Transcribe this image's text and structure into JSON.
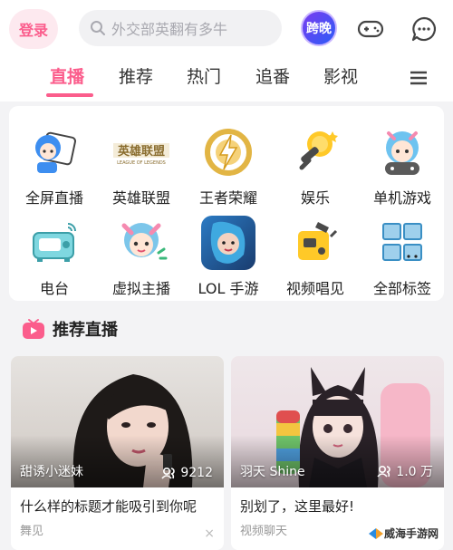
{
  "header": {
    "login_label": "登录",
    "search_placeholder": "外交部英翻有多牛",
    "kuawan_label": "跨晚",
    "icons": [
      "gamepad-icon",
      "chat-icon"
    ]
  },
  "tabs": [
    {
      "label": "直播",
      "active": true
    },
    {
      "label": "推荐",
      "active": false
    },
    {
      "label": "热门",
      "active": false
    },
    {
      "label": "追番",
      "active": false
    },
    {
      "label": "影视",
      "active": false
    }
  ],
  "categories": [
    {
      "label": "全屏直播",
      "icon": "tv-mascot-icon"
    },
    {
      "label": "英雄联盟",
      "icon": "league-of-legends-logo"
    },
    {
      "label": "王者荣耀",
      "icon": "honor-of-kings-icon"
    },
    {
      "label": "娱乐",
      "icon": "microphone-icon"
    },
    {
      "label": "单机游戏",
      "icon": "controller-mascot-icon"
    },
    {
      "label": "电台",
      "icon": "radio-icon"
    },
    {
      "label": "虚拟主播",
      "icon": "virtual-idol-icon"
    },
    {
      "label": "LOL 手游",
      "icon": "lol-mobile-icon"
    },
    {
      "label": "视频唱见",
      "icon": "video-singing-icon"
    },
    {
      "label": "全部标签",
      "icon": "grid-icon"
    }
  ],
  "recommend": {
    "title": "推荐直播",
    "cards": [
      {
        "anchor": "甜诱小迷妹",
        "viewers": "9212",
        "title": "什么样的标题才能吸引到你呢",
        "subtitle": "舞见",
        "close": "×"
      },
      {
        "anchor": "羽天 Shine",
        "viewers": "1.0 万",
        "title": "别划了，这里最好!",
        "subtitle": "视频聊天"
      }
    ]
  },
  "watermark": "威海手游网",
  "colors": {
    "accent": "#fb5d8c",
    "background": "#f3f3f5"
  }
}
